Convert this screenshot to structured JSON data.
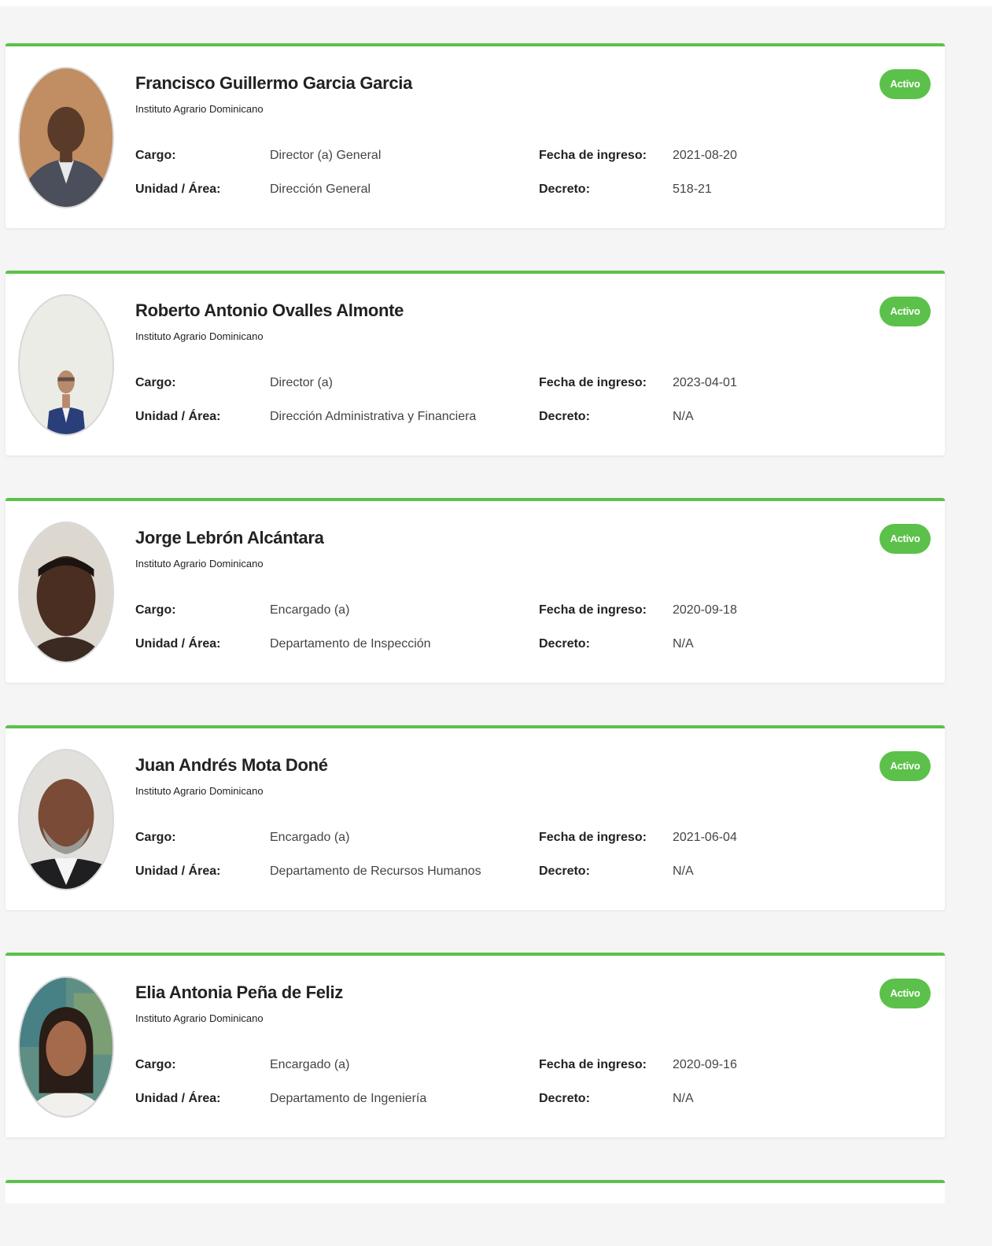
{
  "colors": {
    "accent": "#5cc14a",
    "badge_text": "#ffffff",
    "page_background": "#f5f5f5",
    "card_background": "#ffffff"
  },
  "labels": {
    "cargo": "Cargo:",
    "unidad": "Unidad / Área:",
    "fecha": "Fecha de ingreso:",
    "decreto": "Decreto:"
  },
  "officials": [
    {
      "name": "Francisco Guillermo Garcia Garcia",
      "org": "Instituto Agrario Dominicano",
      "cargo": "Director (a) General",
      "unidad": "Dirección General",
      "fecha": "2021-08-20",
      "decreto": "518-21",
      "status": "Activo"
    },
    {
      "name": "Roberto Antonio Ovalles Almonte",
      "org": "Instituto Agrario Dominicano",
      "cargo": "Director (a)",
      "unidad": "Dirección Administrativa y Financiera",
      "fecha": "2023-04-01",
      "decreto": "N/A",
      "status": "Activo"
    },
    {
      "name": "Jorge Lebrón Alcántara",
      "org": "Instituto Agrario Dominicano",
      "cargo": "Encargado (a)",
      "unidad": "Departamento de Inspección",
      "fecha": "2020-09-18",
      "decreto": "N/A",
      "status": "Activo"
    },
    {
      "name": "Juan Andrés Mota Doné",
      "org": "Instituto Agrario Dominicano",
      "cargo": "Encargado (a)",
      "unidad": "Departamento de Recursos Humanos",
      "fecha": "2021-06-04",
      "decreto": "N/A",
      "status": "Activo"
    },
    {
      "name": "Elia Antonia Peña de Feliz",
      "org": "Instituto Agrario Dominicano",
      "cargo": "Encargado (a)",
      "unidad": "Departamento de Ingeniería",
      "fecha": "2020-09-16",
      "decreto": "N/A",
      "status": "Activo"
    }
  ]
}
